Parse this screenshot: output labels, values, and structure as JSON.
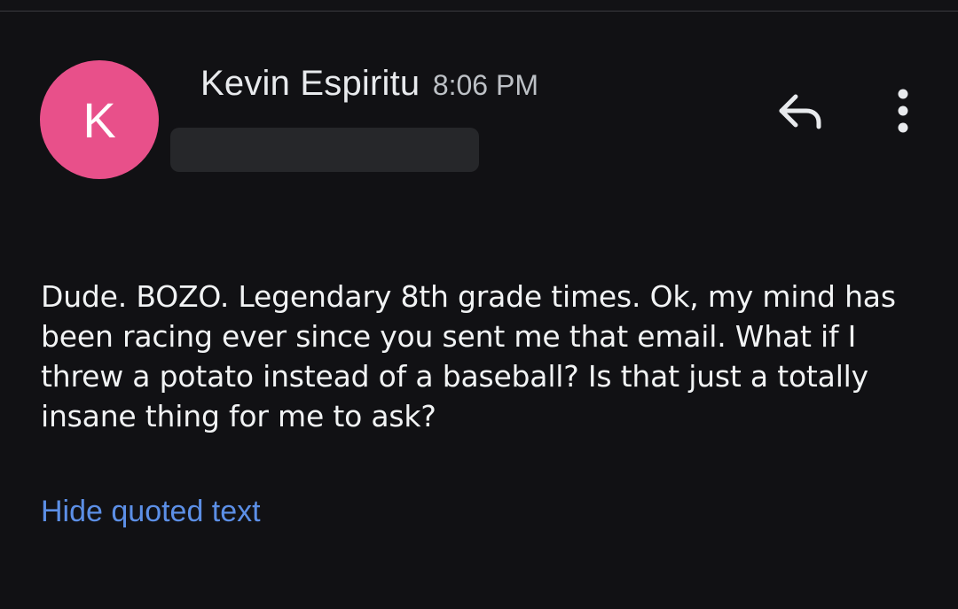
{
  "email": {
    "sender": {
      "avatar_initial": "K",
      "avatar_color": "#e8508a",
      "name": "Kevin Espiritu",
      "time": "8:06 PM"
    },
    "actions": {
      "reply_icon": "reply-icon",
      "more_icon": "more-vert-icon"
    },
    "body": "Dude. BOZO. Legendary 8th grade times. Ok, my mind has been racing ever since you sent me that email. What if I threw a potato instead of a baseball? Is that just a totally insane thing for me to ask?",
    "quoted_toggle_label": "Hide quoted text",
    "link_color": "#5c8fe6"
  }
}
